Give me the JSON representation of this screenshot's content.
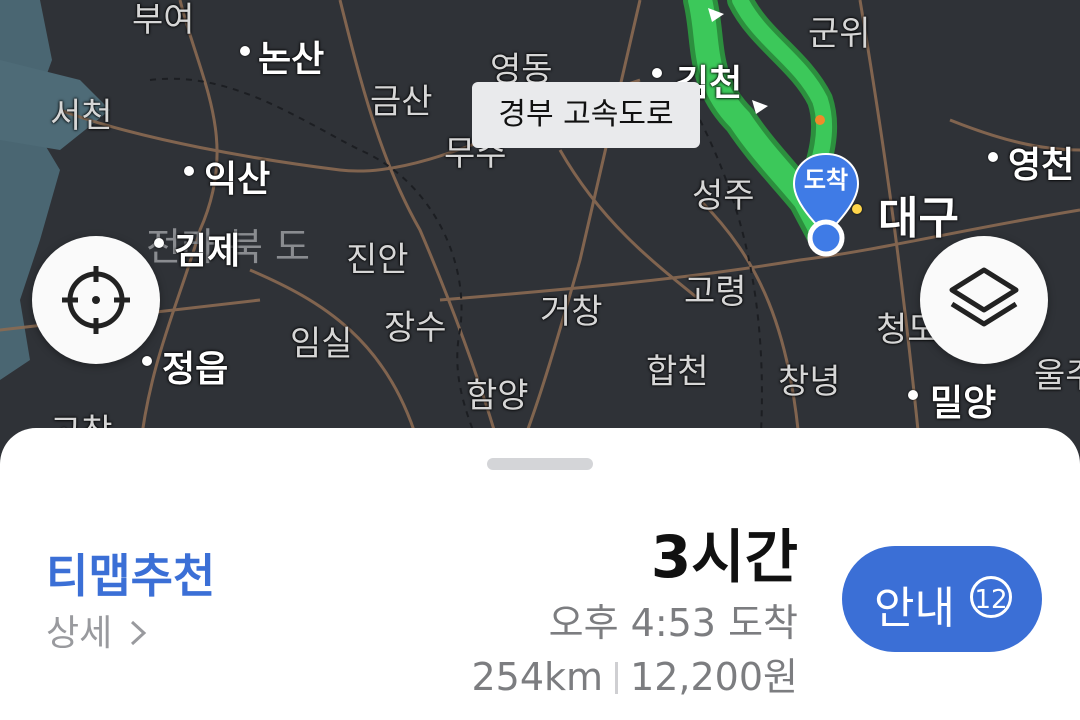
{
  "map": {
    "tooltip": "경부 고속도로",
    "destination_marker": "도착",
    "places": {
      "buyeo": "부여",
      "nonsan": "논산",
      "yeongdong": "영동",
      "gimcheon": "김천",
      "gunwi": "군위",
      "geumsan": "금산",
      "seocheon": "서천",
      "muju": "무주",
      "iksan": "익산",
      "seongju": "성주",
      "daegu": "대구",
      "yeongcheon": "영천",
      "gimje": "김제",
      "jeonbuk": "전라 북 도",
      "jinan": "진안",
      "goryeong": "고령",
      "geochang": "거창",
      "jangsu": "장수",
      "imsil": "임실",
      "cheongdo": "청도",
      "jeongeup": "정읍",
      "hapcheon": "합천",
      "changnyeong": "창녕",
      "miryang": "밀양",
      "ulsan": "울주",
      "hamyang": "함양",
      "gochang": "고창"
    }
  },
  "buttons": {
    "location_icon": "crosshair-icon",
    "layers_icon": "layers-icon"
  },
  "sheet": {
    "route_name": "티맵추천",
    "detail_link": "상세",
    "duration": "3시간",
    "arrival": "오후 4:53 도착",
    "distance": "254km",
    "toll": "12,200원",
    "guide_label": "안내",
    "guide_badge": "12"
  },
  "colors": {
    "accent": "#3b6fd6",
    "route": "#3cc85a",
    "map_bg": "#2f3237",
    "sea": "#4a6672"
  }
}
